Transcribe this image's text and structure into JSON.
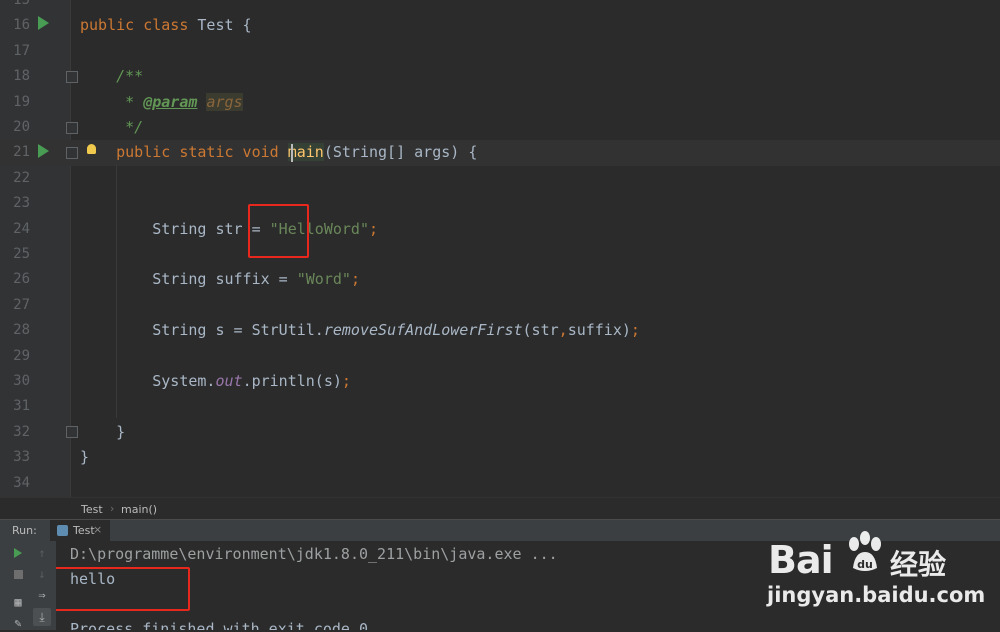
{
  "editor": {
    "lines": [
      {
        "num": "15"
      },
      {
        "num": "16",
        "tokens": [
          [
            "kw",
            "public class "
          ],
          [
            "plain",
            "Test {"
          ]
        ]
      },
      {
        "num": "17"
      },
      {
        "num": "18",
        "tokens": [
          [
            "cmt",
            "    /**"
          ]
        ]
      },
      {
        "num": "19",
        "tokens": [
          [
            "cmt",
            "     * "
          ],
          [
            "tag",
            "@param"
          ],
          [
            "cmt",
            " "
          ],
          [
            "paramname",
            "args"
          ]
        ]
      },
      {
        "num": "20",
        "tokens": [
          [
            "cmt",
            "     */"
          ]
        ]
      },
      {
        "num": "21",
        "tokens": [
          [
            "kw",
            "    public static void "
          ],
          [
            "method",
            "main"
          ],
          [
            "plain",
            "(String[] args) {"
          ]
        ]
      },
      {
        "num": "22"
      },
      {
        "num": "23"
      },
      {
        "num": "24",
        "tokens": [
          [
            "plain",
            "        String str = "
          ],
          [
            "str",
            "\"HelloWord\""
          ],
          [
            "kw",
            ";"
          ]
        ]
      },
      {
        "num": "25"
      },
      {
        "num": "26",
        "tokens": [
          [
            "plain",
            "        String suffix = "
          ],
          [
            "str",
            "\"Word\""
          ],
          [
            "kw",
            ";"
          ]
        ]
      },
      {
        "num": "27"
      },
      {
        "num": "28",
        "tokens": [
          [
            "plain",
            "        String s = StrUtil."
          ],
          [
            "staticm",
            "removeSufAndLowerFirst"
          ],
          [
            "plain",
            "(str"
          ],
          [
            "kw",
            ","
          ],
          [
            "plain",
            "suffix)"
          ],
          [
            "kw",
            ";"
          ]
        ]
      },
      {
        "num": "29"
      },
      {
        "num": "30",
        "tokens": [
          [
            "plain",
            "        System."
          ],
          [
            "staticf",
            "out"
          ],
          [
            "plain",
            ".println(s)"
          ],
          [
            "kw",
            ";"
          ]
        ]
      },
      {
        "num": "31"
      },
      {
        "num": "32",
        "tokens": [
          [
            "plain",
            "    }"
          ]
        ]
      },
      {
        "num": "33",
        "tokens": [
          [
            "plain",
            "}"
          ]
        ]
      },
      {
        "num": "34"
      }
    ]
  },
  "breadcrumb": {
    "class": "Test",
    "method": "main()"
  },
  "run_panel": {
    "label": "Run:",
    "tab_label": "Test",
    "tab_close": "×",
    "console": {
      "command": "D:\\programme\\environment\\jdk1.8.0_211\\bin\\java.exe ...",
      "output": "hello",
      "exit": "Process finished with exit code 0"
    }
  },
  "watermark": {
    "brand": "Bai",
    "brand_cn": "经验",
    "url": "jingyan.baidu.com"
  },
  "colors": {
    "accent_red": "#e8271d",
    "run_green": "#499c54",
    "background": "#2b2b2b"
  }
}
